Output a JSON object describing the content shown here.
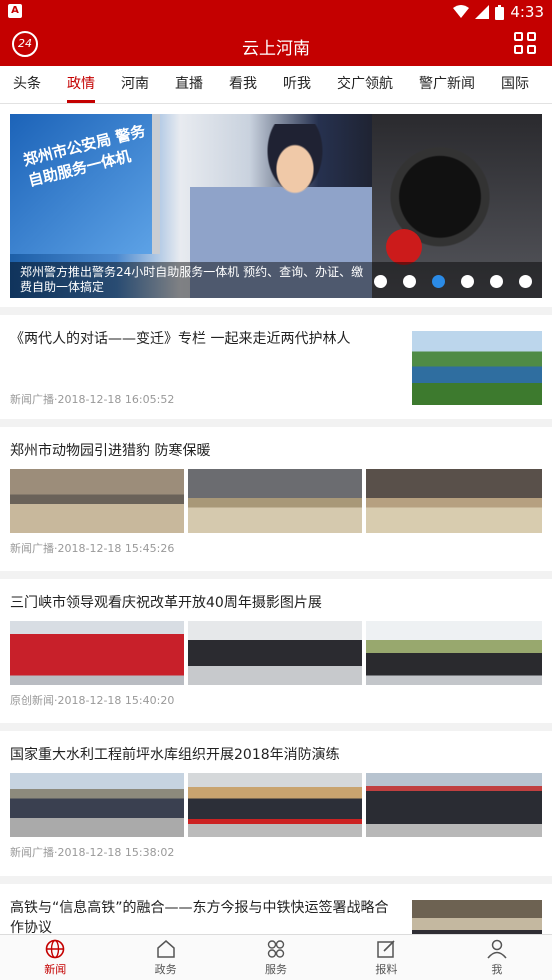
{
  "status": {
    "time": "4:33",
    "notif_letter": "A"
  },
  "app": {
    "title": "云上河南",
    "logo_text": "24"
  },
  "tabs": [
    "头条",
    "政情",
    "河南",
    "直播",
    "看我",
    "听我",
    "交广领航",
    "警广新闻",
    "国际"
  ],
  "active_tab": 1,
  "banner": {
    "caption": "郑州警方推出警务24小时自助服务一体机 预约、查询、办证、缴费自助一体搞定",
    "monitor_text": "郑州市公安局 警务自助服务一体机",
    "slide_count": 6,
    "active_slide": 3
  },
  "articles": [
    {
      "title": "《两代人的对话——变迁》专栏  一起来走近两代护林人",
      "meta": "新闻广播·2018-12-18 16:05:52"
    },
    {
      "title": "郑州市动物园引进猎豹 防寒保暖",
      "meta": "新闻广播·2018-12-18 15:45:26"
    },
    {
      "title": "三门峡市领导观看庆祝改革开放40周年摄影图片展",
      "meta": "原创新闻·2018-12-18 15:40:20"
    },
    {
      "title": "国家重大水利工程前坪水库组织开展2018年消防演练",
      "meta": "新闻广播·2018-12-18 15:38:02"
    },
    {
      "title": "高铁与“信息高铁”的融合——东方今报与中铁快运签署战略合作协议"
    }
  ],
  "bottom_nav": [
    {
      "label": "新闻",
      "icon": "globe-icon"
    },
    {
      "label": "政务",
      "icon": "home-icon"
    },
    {
      "label": "服务",
      "icon": "grid-icon"
    },
    {
      "label": "报料",
      "icon": "edit-icon"
    },
    {
      "label": "我",
      "icon": "person-icon"
    }
  ],
  "colors": {
    "brand": "#c40000",
    "active_dot": "#2b8be6"
  }
}
